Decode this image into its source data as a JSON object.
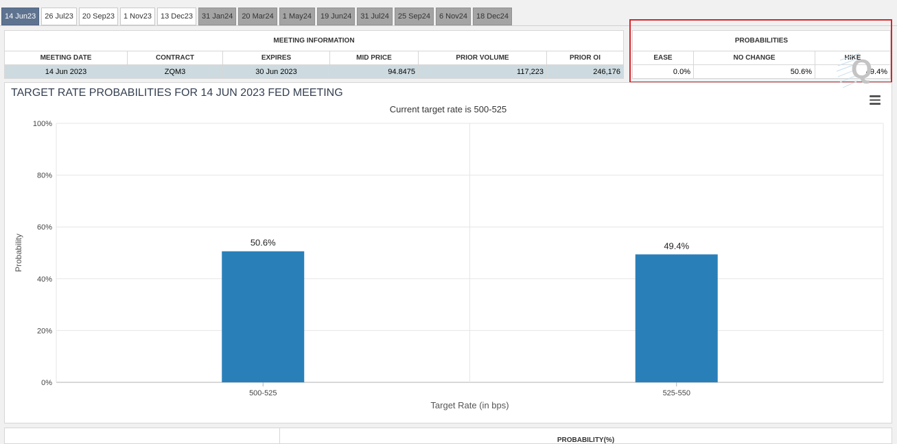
{
  "tabs": [
    {
      "label": "14 Jun23",
      "state": "active"
    },
    {
      "label": "26 Jul23",
      "state": "normal"
    },
    {
      "label": "20 Sep23",
      "state": "normal"
    },
    {
      "label": "1 Nov23",
      "state": "normal"
    },
    {
      "label": "13 Dec23",
      "state": "normal"
    },
    {
      "label": "31 Jan24",
      "state": "future"
    },
    {
      "label": "20 Mar24",
      "state": "future"
    },
    {
      "label": "1 May24",
      "state": "future"
    },
    {
      "label": "19 Jun24",
      "state": "future"
    },
    {
      "label": "31 Jul24",
      "state": "future"
    },
    {
      "label": "25 Sep24",
      "state": "future"
    },
    {
      "label": "6 Nov24",
      "state": "future"
    },
    {
      "label": "18 Dec24",
      "state": "future"
    }
  ],
  "meeting_info": {
    "title": "MEETING INFORMATION",
    "headers": [
      "MEETING DATE",
      "CONTRACT",
      "EXPIRES",
      "MID PRICE",
      "PRIOR VOLUME",
      "PRIOR OI"
    ],
    "values": [
      "14 Jun 2023",
      "ZQM3",
      "30 Jun 2023",
      "94.8475",
      "117,223",
      "246,176"
    ]
  },
  "probabilities": {
    "title": "PROBABILITIES",
    "headers": [
      "EASE",
      "NO CHANGE",
      "HIKE"
    ],
    "values": [
      "0.0%",
      "50.6%",
      "49.4%"
    ]
  },
  "colors": {
    "accent": "#5e7390",
    "bar": "#2980b9",
    "highlight": "#d9222a"
  },
  "icons": {
    "menu": "hamburger-menu-icon",
    "logo": "quikstrike-logo-icon"
  },
  "chart_data": {
    "type": "bar",
    "title": "TARGET RATE PROBABILITIES FOR 14 JUN 2023 FED MEETING",
    "subtitle": "Current target rate is 500-525",
    "xlabel": "Target Rate (in bps)",
    "ylabel": "Probability",
    "categories": [
      "500-525",
      "525-550"
    ],
    "values": [
      50.6,
      49.4
    ],
    "data_labels": [
      "50.6%",
      "49.4%"
    ],
    "yticks": [
      "0%",
      "20%",
      "40%",
      "60%",
      "80%",
      "100%"
    ],
    "ylim": [
      0,
      100
    ],
    "grid": true,
    "bar_color": "#2980b9"
  },
  "bottom_table": {
    "header": "PROBABILITY(%)"
  }
}
